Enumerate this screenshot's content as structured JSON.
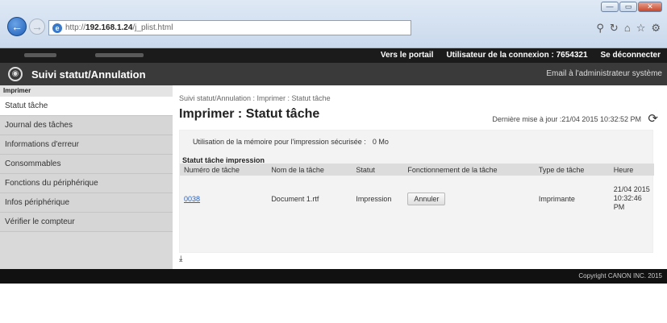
{
  "browser": {
    "url_prefix": "http://",
    "url_host": "192.168.1.24",
    "url_path": "/j_plist.html",
    "window_buttons": [
      "—",
      "▭",
      "✕"
    ],
    "toolbar_icons": [
      "search-icon",
      "refresh-icon",
      "home-icon",
      "star-icon",
      "gear-icon"
    ]
  },
  "topbar": {
    "portal": "Vers le portail",
    "user_label": "Utilisateur de la connexion :",
    "user_id": "7654321",
    "logout": "Se déconnecter"
  },
  "header": {
    "title": "Suivi statut/Annulation",
    "email_admin": "Email à l'administrateur système"
  },
  "sidebar": {
    "heading": "Imprimer",
    "items": [
      {
        "label": "Statut tâche",
        "active": true
      },
      {
        "label": "Journal des tâches"
      },
      {
        "label": "Informations d'erreur"
      },
      {
        "label": "Consommables"
      },
      {
        "label": "Fonctions du périphérique"
      },
      {
        "label": "Infos périphérique"
      },
      {
        "label": "Vérifier le compteur"
      }
    ]
  },
  "main": {
    "breadcrumb": "Suivi statut/Annulation : Imprimer : Statut tâche",
    "title": "Imprimer : Statut tâche",
    "last_update": "Dernière mise à jour :21/04 2015 10:32:52 PM",
    "memory_label": "Utilisation de la mémoire pour l'impression sécurisée :",
    "memory_value": "0 Mo",
    "job_section": "Statut tâche impression",
    "columns": [
      "Numéro de tâche",
      "Nom de la tâche",
      "Statut",
      "Fonctionnement de la tâche",
      "Type de tâche",
      "Heure"
    ],
    "rows": [
      {
        "job_no": "0038",
        "name": "Document 1.rtf",
        "status": "Impression",
        "action": "Annuler",
        "type": "Imprimante",
        "hour": "21/04 2015 10:32:46 PM"
      }
    ]
  },
  "footer": {
    "copyright": "Copyright CANON INC. 2015"
  }
}
